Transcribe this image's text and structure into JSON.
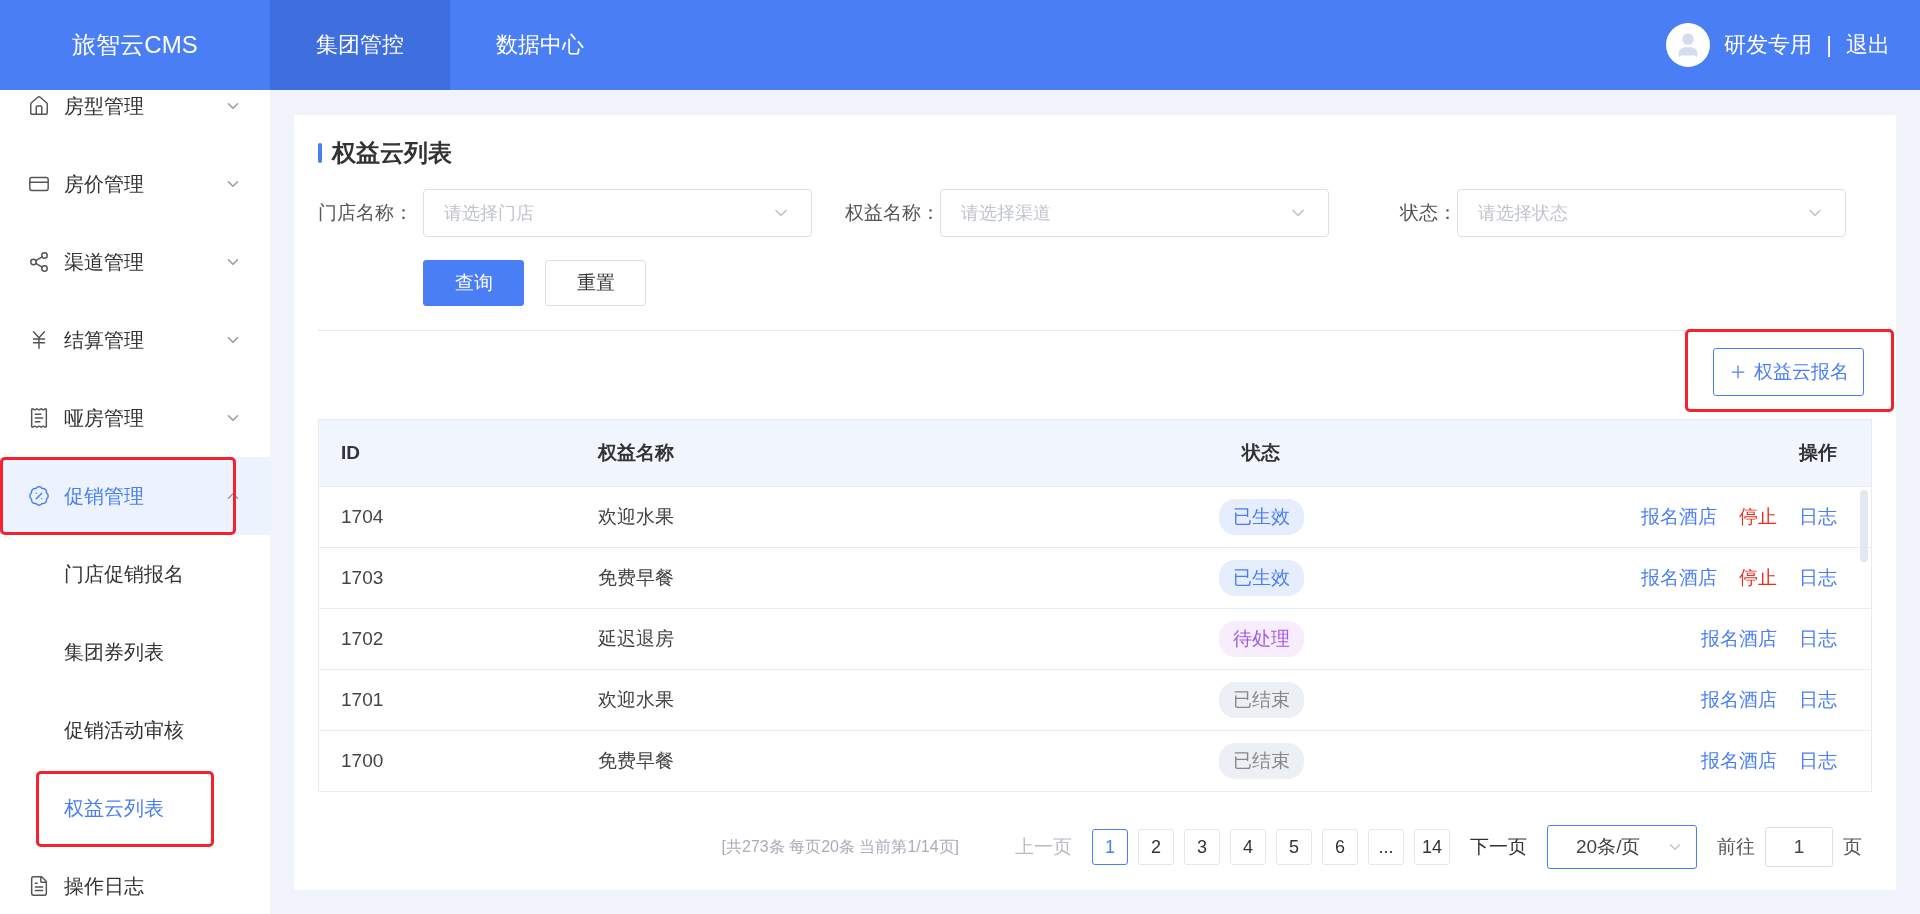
{
  "header": {
    "logo": "旅智云CMS",
    "tabs": [
      {
        "label": "集团管控",
        "selected": true
      },
      {
        "label": "数据中心",
        "selected": false
      }
    ],
    "user": "研发专用",
    "separator": "|",
    "logout": "退出"
  },
  "sidebar": {
    "items": [
      {
        "label": "房型管理",
        "kind": "group",
        "expanded": false,
        "selected": false,
        "highlighted": false
      },
      {
        "label": "房价管理",
        "kind": "group",
        "expanded": false,
        "selected": false,
        "highlighted": false
      },
      {
        "label": "渠道管理",
        "kind": "group",
        "expanded": false,
        "selected": false,
        "highlighted": false
      },
      {
        "label": "结算管理",
        "kind": "group",
        "expanded": false,
        "selected": false,
        "highlighted": false
      },
      {
        "label": "哑房管理",
        "kind": "group",
        "expanded": false,
        "selected": false,
        "highlighted": false
      },
      {
        "label": "促销管理",
        "kind": "group",
        "expanded": true,
        "selected": true,
        "highlighted": true,
        "children": [
          {
            "label": "门店促销报名",
            "selected": false,
            "highlighted": false
          },
          {
            "label": "集团券列表",
            "selected": false,
            "highlighted": false
          },
          {
            "label": "促销活动审核",
            "selected": false,
            "highlighted": false
          },
          {
            "label": "权益云列表",
            "selected": true,
            "highlighted": true
          }
        ]
      },
      {
        "label": "操作日志",
        "kind": "link",
        "expanded": false,
        "selected": false,
        "highlighted": false
      }
    ]
  },
  "page": {
    "title": "权益云列表",
    "filters": [
      {
        "label": "门店名称：",
        "placeholder": "请选择门店"
      },
      {
        "label": "权益名称：",
        "placeholder": "请选择渠道"
      },
      {
        "label": "状态：",
        "placeholder": "请选择状态"
      }
    ],
    "buttons": [
      {
        "label": "查询",
        "kind": "primary"
      },
      {
        "label": "重置",
        "kind": "default"
      }
    ],
    "add_button": {
      "label": "权益云报名",
      "highlighted": true
    },
    "table": {
      "columns": [
        "ID",
        "权益名称",
        "状态",
        "操作"
      ],
      "rows": [
        {
          "id": "1704",
          "name": "欢迎水果",
          "status": {
            "label": "已生效",
            "kind": "active"
          },
          "actions": [
            {
              "label": "报名酒店",
              "kind": "link"
            },
            {
              "label": "停止",
              "kind": "danger"
            },
            {
              "label": "日志",
              "kind": "link"
            }
          ]
        },
        {
          "id": "1703",
          "name": "免费早餐",
          "status": {
            "label": "已生效",
            "kind": "active"
          },
          "actions": [
            {
              "label": "报名酒店",
              "kind": "link"
            },
            {
              "label": "停止",
              "kind": "danger"
            },
            {
              "label": "日志",
              "kind": "link"
            }
          ]
        },
        {
          "id": "1702",
          "name": "延迟退房",
          "status": {
            "label": "待处理",
            "kind": "pending"
          },
          "actions": [
            {
              "label": "报名酒店",
              "kind": "link"
            },
            {
              "label": "日志",
              "kind": "link"
            }
          ]
        },
        {
          "id": "1701",
          "name": "欢迎水果",
          "status": {
            "label": "已结束",
            "kind": "ended"
          },
          "actions": [
            {
              "label": "报名酒店",
              "kind": "link"
            },
            {
              "label": "日志",
              "kind": "link"
            }
          ]
        },
        {
          "id": "1700",
          "name": "免费早餐",
          "status": {
            "label": "已结束",
            "kind": "ended"
          },
          "actions": [
            {
              "label": "报名酒店",
              "kind": "link"
            },
            {
              "label": "日志",
              "kind": "link"
            }
          ]
        }
      ]
    },
    "pagination": {
      "summary": "[共273条 每页20条 当前第1/14页]",
      "prev": {
        "label": "上一页",
        "disabled": true
      },
      "pages": [
        {
          "label": "1",
          "selected": true
        },
        {
          "label": "2",
          "selected": false
        },
        {
          "label": "3",
          "selected": false
        },
        {
          "label": "4",
          "selected": false
        },
        {
          "label": "5",
          "selected": false
        },
        {
          "label": "6",
          "selected": false
        },
        {
          "label": "...",
          "selected": false
        },
        {
          "label": "14",
          "selected": false
        }
      ],
      "next": {
        "label": "下一页",
        "disabled": false
      },
      "page_size": "20条/页",
      "goto_label": "前往",
      "goto_value": "1",
      "goto_suffix": "页"
    }
  }
}
